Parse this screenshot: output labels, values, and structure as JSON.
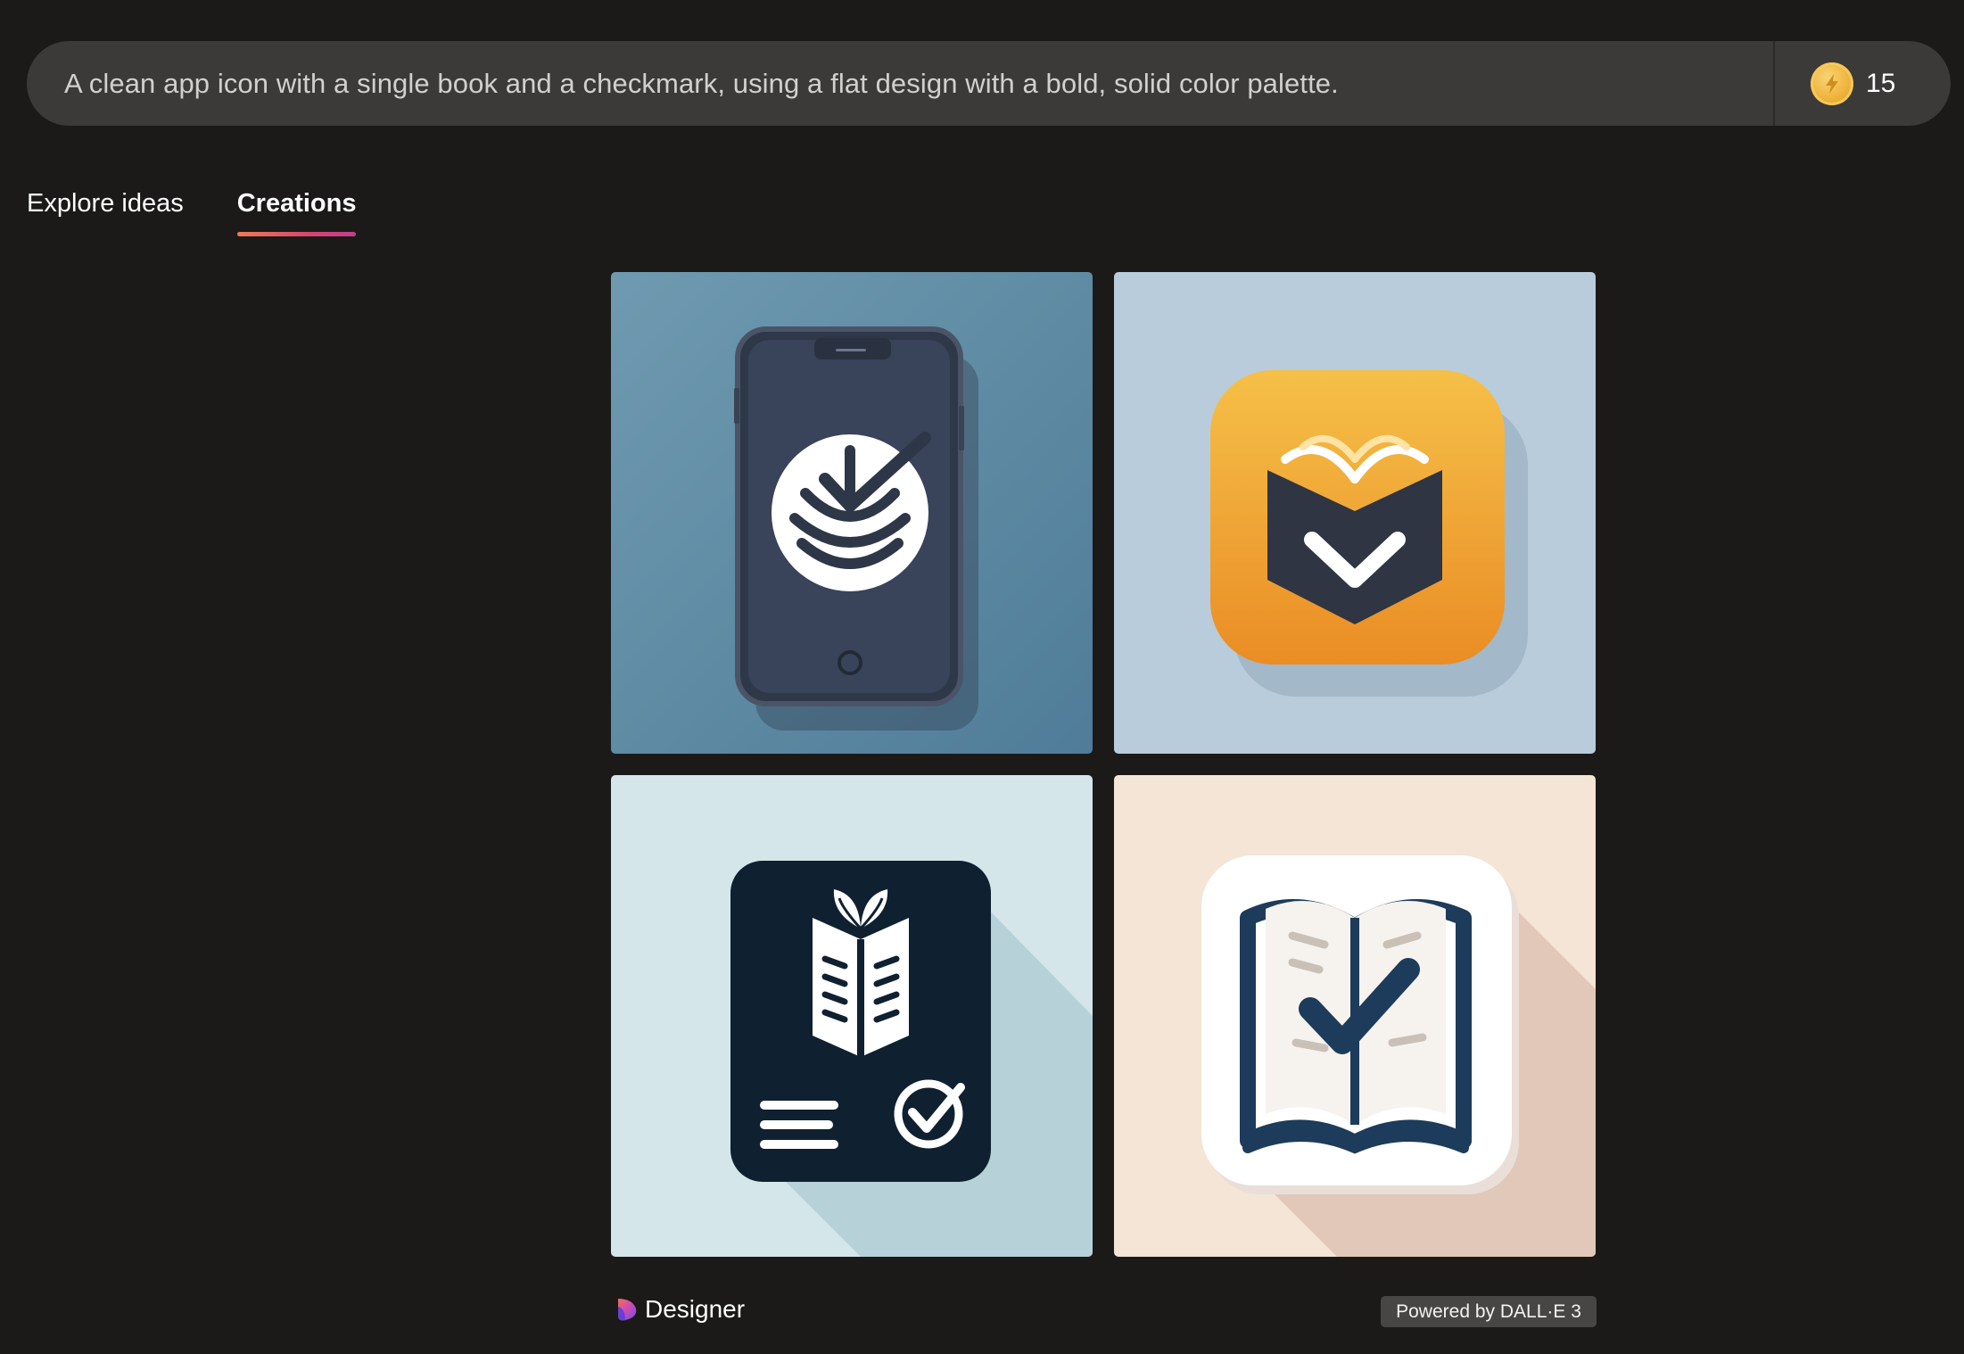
{
  "prompt": {
    "text": "A clean app icon with a single book and a checkmark, using a flat design with a bold, solid color palette."
  },
  "boosts": {
    "icon": "coin-boost-icon",
    "count": "15"
  },
  "tabs": [
    {
      "label": "Explore ideas",
      "active": false
    },
    {
      "label": "Creations",
      "active": true
    }
  ],
  "images": [
    {
      "icon": "phone-book-check-image"
    },
    {
      "icon": "orange-book-chevron-image"
    },
    {
      "icon": "dark-book-leaves-check-image"
    },
    {
      "icon": "open-book-check-image"
    }
  ],
  "footer": {
    "brand": "Designer",
    "powered_by": "Powered by DALL·E 3"
  },
  "colors": {
    "background": "#1b1a19",
    "prompt_bar": "#3b3a39",
    "tab_underline": "#d6456f",
    "coin": "#f0b43d"
  }
}
